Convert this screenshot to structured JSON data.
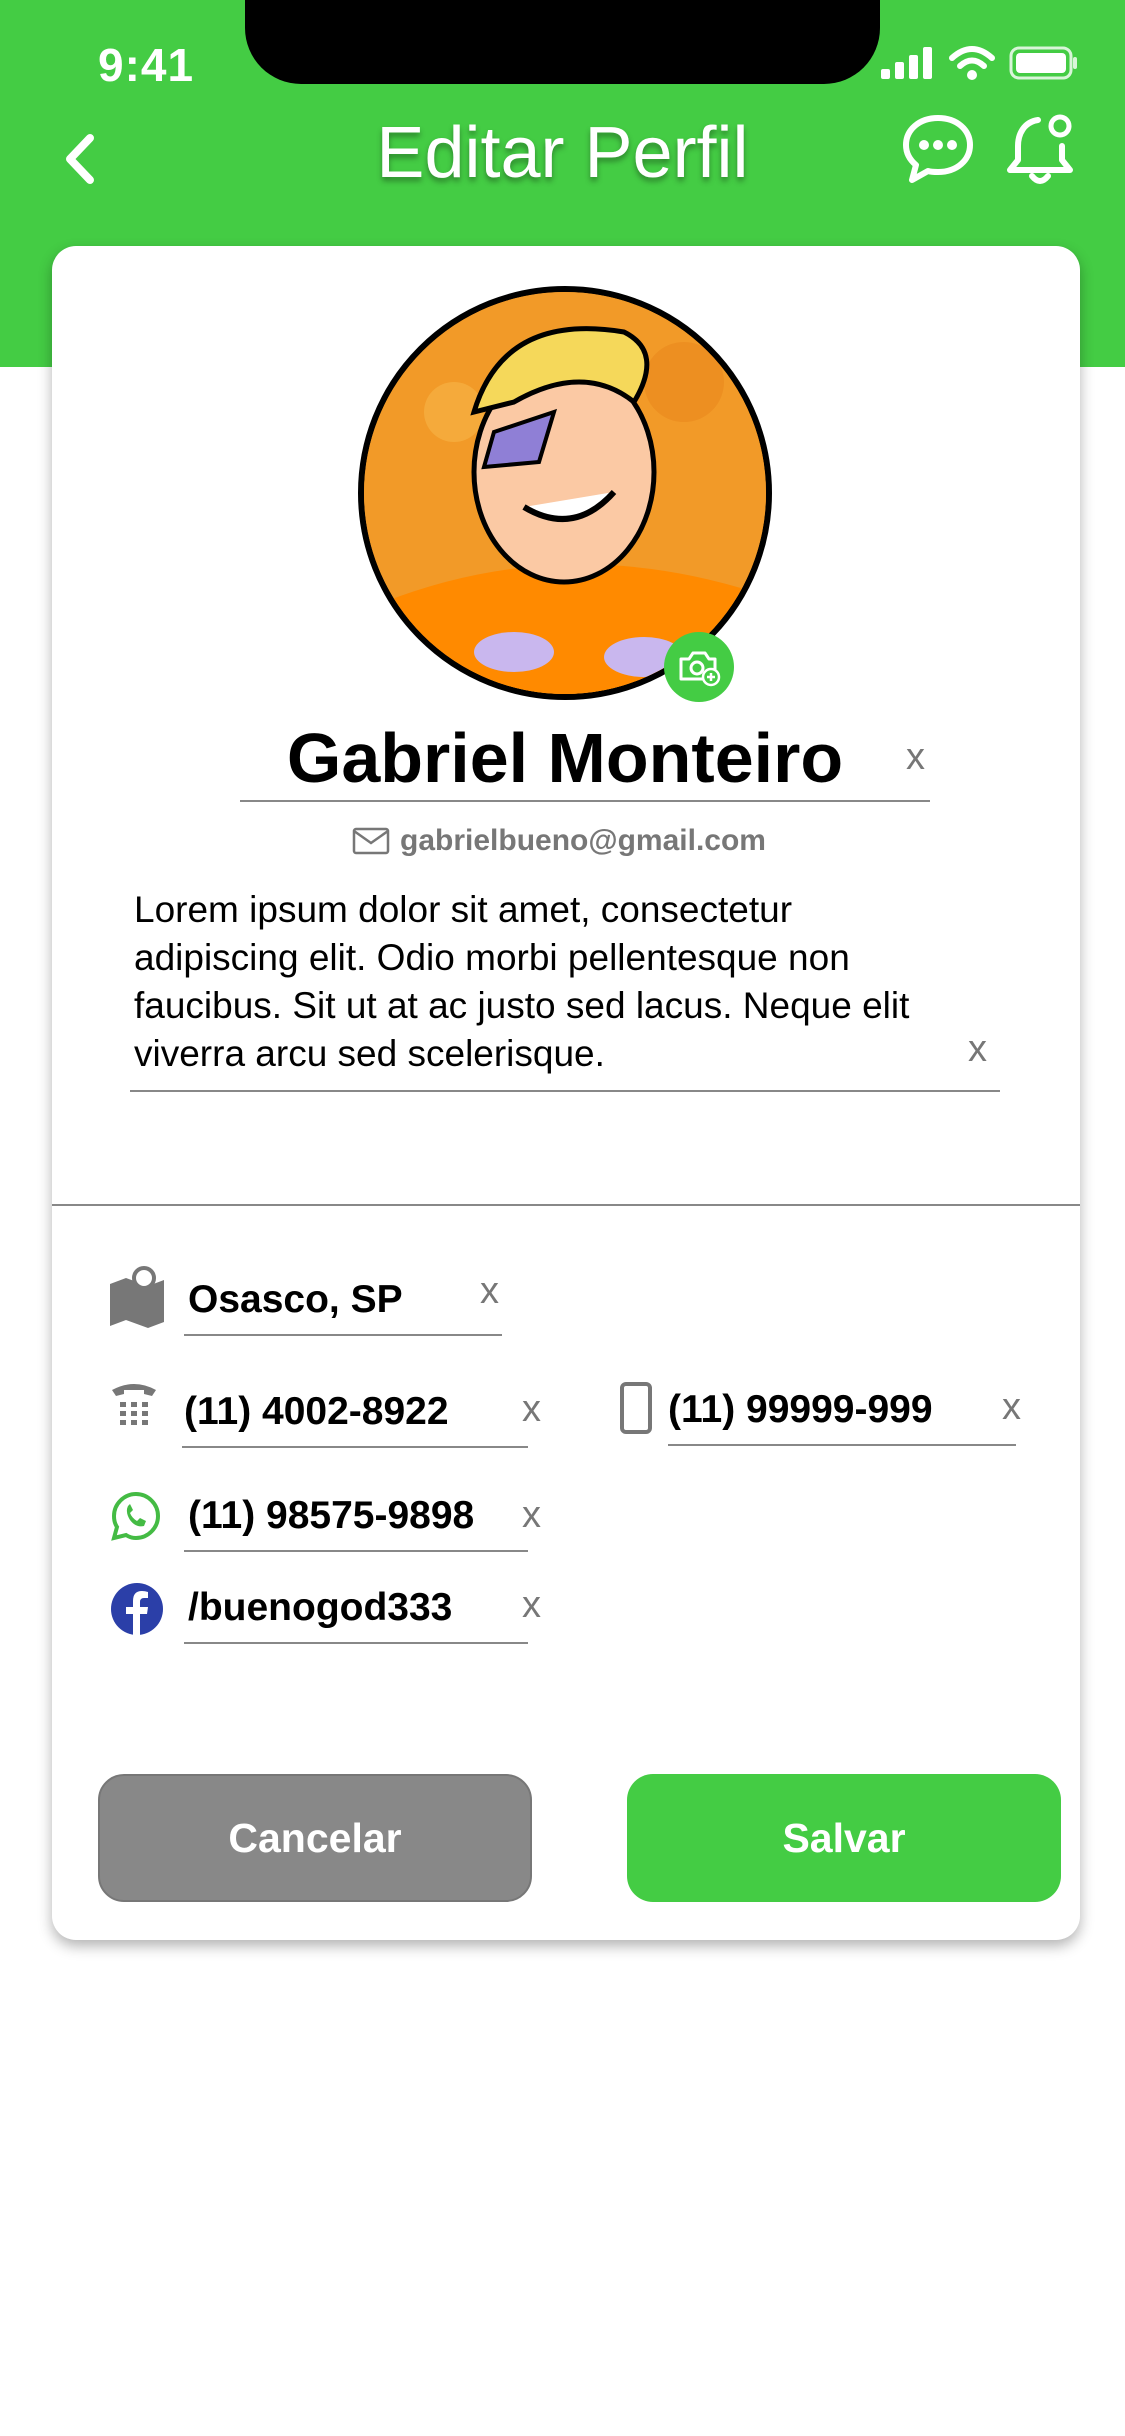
{
  "status_bar": {
    "time": "9:41"
  },
  "header": {
    "title": "Editar Perfil"
  },
  "profile": {
    "name": "Gabriel Monteiro",
    "email": "gabrielbueno@gmail.com",
    "bio": "Lorem ipsum dolor sit amet, consectetur adipiscing elit. Odio morbi pellentesque non faucibus. Sit ut at ac justo sed lacus. Neque elit viverra arcu sed scelerisque.",
    "clear_label": "x"
  },
  "contacts": {
    "location": "Osasco, SP",
    "landline": "(11) 4002-8922",
    "mobile": "(11) 99999-999",
    "whatsapp": "(11) 98575-9898",
    "facebook": "/buenogod333"
  },
  "actions": {
    "cancel_label": "Cancelar",
    "save_label": "Salvar"
  },
  "colors": {
    "accent": "#44CC44",
    "cancel": "#888888",
    "facebook": "#2B3FA8"
  }
}
